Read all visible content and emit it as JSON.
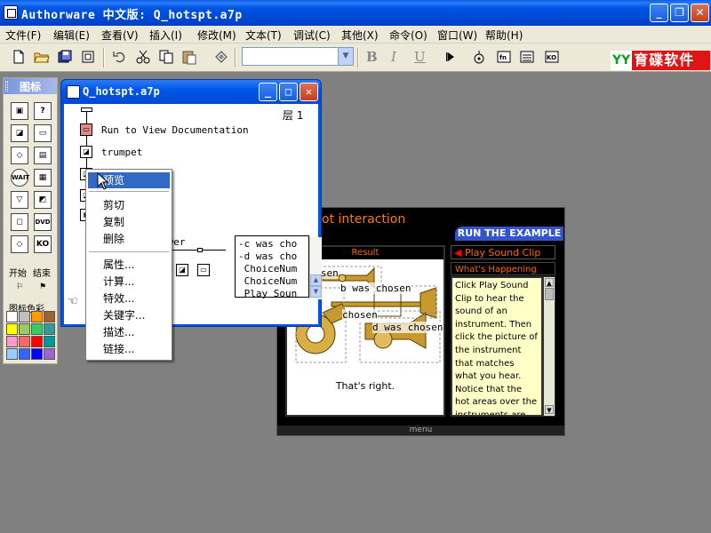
{
  "app": {
    "title": "Authorware 中文版: Q_hotspt.a7p",
    "min_glyph": "_",
    "max_glyph": "❐",
    "close_glyph": "✕"
  },
  "menubar": [
    {
      "label": "文件(F)"
    },
    {
      "label": "编辑(E)"
    },
    {
      "label": "查看(V)"
    },
    {
      "label": "插入(I)"
    },
    {
      "label": "修改(M)"
    },
    {
      "label": "文本(T)"
    },
    {
      "label": "调试(C)"
    },
    {
      "label": "其他(X)"
    },
    {
      "label": "命令(O)"
    },
    {
      "label": "窗口(W)"
    },
    {
      "label": "帮助(H)"
    }
  ],
  "toolbar": {
    "font_value": "",
    "bold": "B",
    "italic": "I",
    "underline": "U",
    "brand_logo": "YY",
    "brand_name": "育碟软件"
  },
  "palette": {
    "title": "图标",
    "start_label": "开始",
    "end_label": "结束",
    "colors_label": "图标色彩",
    "wait_label": "WAIT",
    "dvd_label": "DVD",
    "ko_label": "KO",
    "swatches": [
      "#ffffff",
      "#c0c0c0",
      "#ff9900",
      "#996633",
      "#ffff00",
      "#99cc66",
      "#33cc66",
      "#339999",
      "#ff99cc",
      "#ff6666",
      "#ff0000",
      "#009999",
      "#99ccff",
      "#3366ff",
      "#0000ff",
      "#9966cc"
    ]
  },
  "design_window": {
    "title": "Q_hotspt.a7p",
    "level": "层 1",
    "flow_items": [
      {
        "label": "Run to View Documentation"
      },
      {
        "label": "trumpet"
      }
    ],
    "answer_fragment": "swer",
    "feedback_lines": [
      "-c was cho",
      "-d was cho",
      " ChoiceNum",
      " ChoiceNum",
      " Play Soun"
    ]
  },
  "context_menu": {
    "items": [
      {
        "label": "预览",
        "highlighted": true
      },
      {
        "label": "剪切"
      },
      {
        "label": "复制"
      },
      {
        "label": "删除"
      },
      {
        "label": "属性..."
      },
      {
        "label": "计算..."
      },
      {
        "label": "特效..."
      },
      {
        "label": "关键字..."
      },
      {
        "label": "描述..."
      },
      {
        "label": "链接..."
      }
    ]
  },
  "presentation": {
    "title_fragment": "ot interaction",
    "run_label": "RUN THE EXAMPLE",
    "result_header": "Result",
    "play_sound": "Play Sound Clip",
    "whats_happening": "What's Happening",
    "hotspot_labels": [
      "chosen",
      "b was chosen",
      "chosen",
      "d was chosen"
    ],
    "result_text": "That's right.",
    "description": "Click Play Sound Clip to hear the sound of an instrument. Then click the picture of the instrument that matches what you hear. Notice that the hot areas over the instruments are all",
    "menu_label": "menu",
    "accent_color": "#ff6600"
  }
}
